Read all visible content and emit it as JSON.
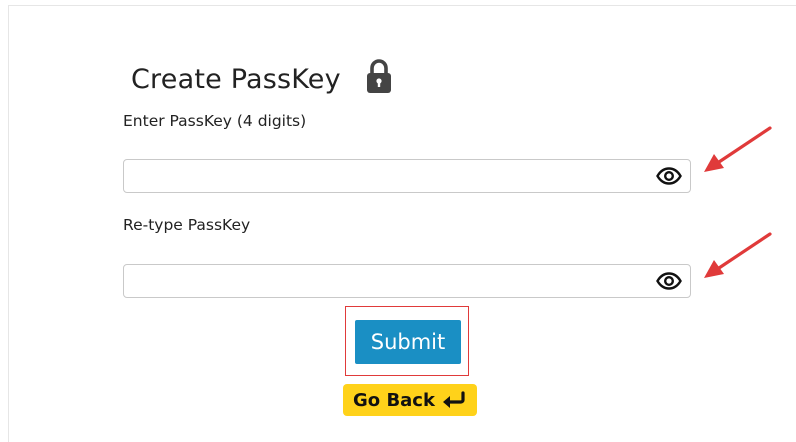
{
  "form": {
    "title": "Create PassKey",
    "passkey_label": "Enter PassKey (4 digits)",
    "passkey_value": "",
    "retype_label": "Re-type PassKey",
    "retype_value": "",
    "submit_label": "Submit",
    "goback_label": "Go Back"
  },
  "icons": {
    "title_icon": "lock-icon",
    "field_toggle_icon": "eye-icon",
    "goback_icon": "return-arrow-icon",
    "annotation_icon": "red-arrow-annotation"
  },
  "colors": {
    "submit_bg": "#1a8fc4",
    "goback_bg": "#ffd21a",
    "annotation_red": "#e03a3a",
    "lock_icon": "#444444"
  }
}
